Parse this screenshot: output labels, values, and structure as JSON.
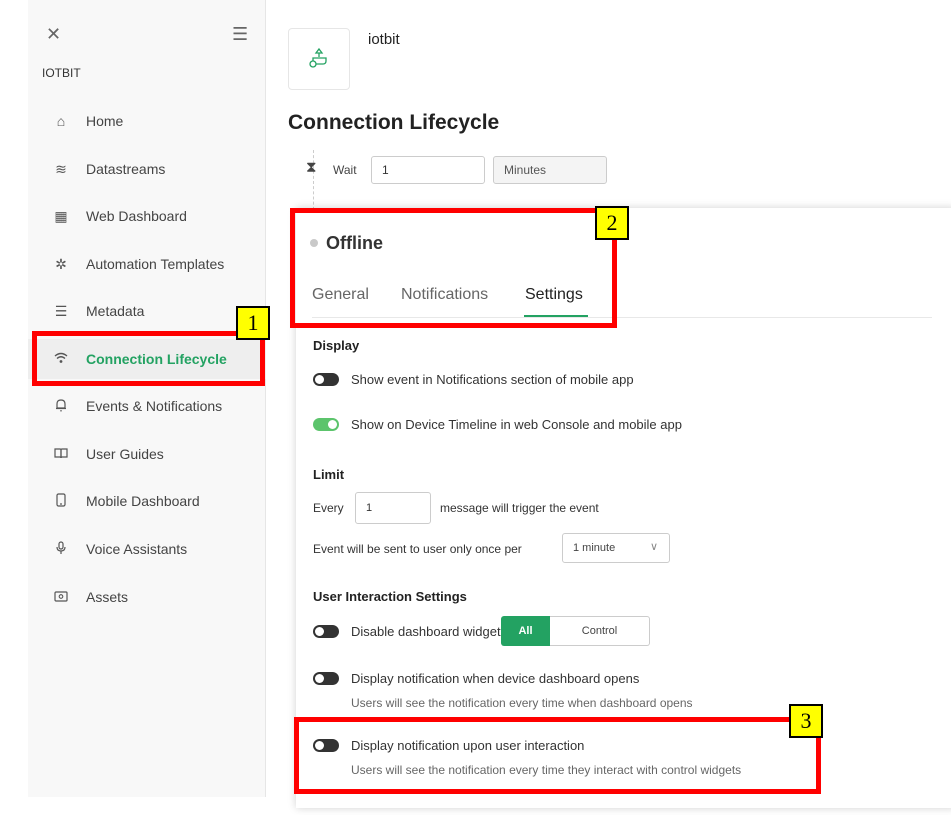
{
  "sidebar": {
    "close_icon": "close-icon",
    "menu_icon": "hamburger-menu-icon",
    "org_name": "IOTBIT",
    "items": [
      {
        "label": "Home",
        "icon": "home-icon"
      },
      {
        "label": "Datastreams",
        "icon": "datastreams-icon"
      },
      {
        "label": "Web Dashboard",
        "icon": "web-dashboard-icon"
      },
      {
        "label": "Automation Templates",
        "icon": "automation-icon"
      },
      {
        "label": "Metadata",
        "icon": "metadata-icon"
      },
      {
        "label": "Connection Lifecycle",
        "icon": "wifi-icon",
        "active": true
      },
      {
        "label": "Events & Notifications",
        "icon": "bell-icon"
      },
      {
        "label": "User Guides",
        "icon": "book-icon"
      },
      {
        "label": "Mobile Dashboard",
        "icon": "mobile-icon"
      },
      {
        "label": "Voice Assistants",
        "icon": "microphone-icon"
      },
      {
        "label": "Assets",
        "icon": "assets-icon"
      }
    ]
  },
  "header": {
    "product_name": "iotbit",
    "product_icon": "product-template-icon"
  },
  "page": {
    "title": "Connection Lifecycle"
  },
  "wait": {
    "label": "Wait",
    "value": "1",
    "unit": "Minutes"
  },
  "panel": {
    "state_title": "Offline",
    "tabs": [
      {
        "label": "General"
      },
      {
        "label": "Notifications"
      },
      {
        "label": "Settings",
        "active": true
      }
    ],
    "display": {
      "title": "Display",
      "show_notifications": {
        "label": "Show event in Notifications section of mobile app",
        "on": false
      },
      "show_timeline": {
        "label": "Show on Device Timeline in web Console and mobile app",
        "on": true
      }
    },
    "limit": {
      "title": "Limit",
      "every_label": "Every",
      "every_value": "1",
      "every_suffix": "message will trigger the event",
      "once_label": "Event will be sent to user only once per",
      "once_value": "1 minute"
    },
    "user_interaction": {
      "title": "User Interaction Settings",
      "disable_widgets": {
        "label": "Disable dashboard widgets",
        "on": false
      },
      "segment_all": "All",
      "segment_control": "Control",
      "display_on_open": {
        "label": "Display notification when device dashboard opens",
        "hint": "Users will see the notification every time when dashboard opens",
        "on": false
      },
      "display_on_interaction": {
        "label": "Display notification upon user interaction",
        "hint": "Users will see the notification every time they interact with control widgets",
        "on": false
      }
    }
  },
  "annotations": [
    "1",
    "2",
    "3"
  ],
  "colors": {
    "accent": "#23a262",
    "toggle_on": "#5cc46c",
    "annotation_red": "#ff0000",
    "badge_yellow": "#ffff00"
  }
}
